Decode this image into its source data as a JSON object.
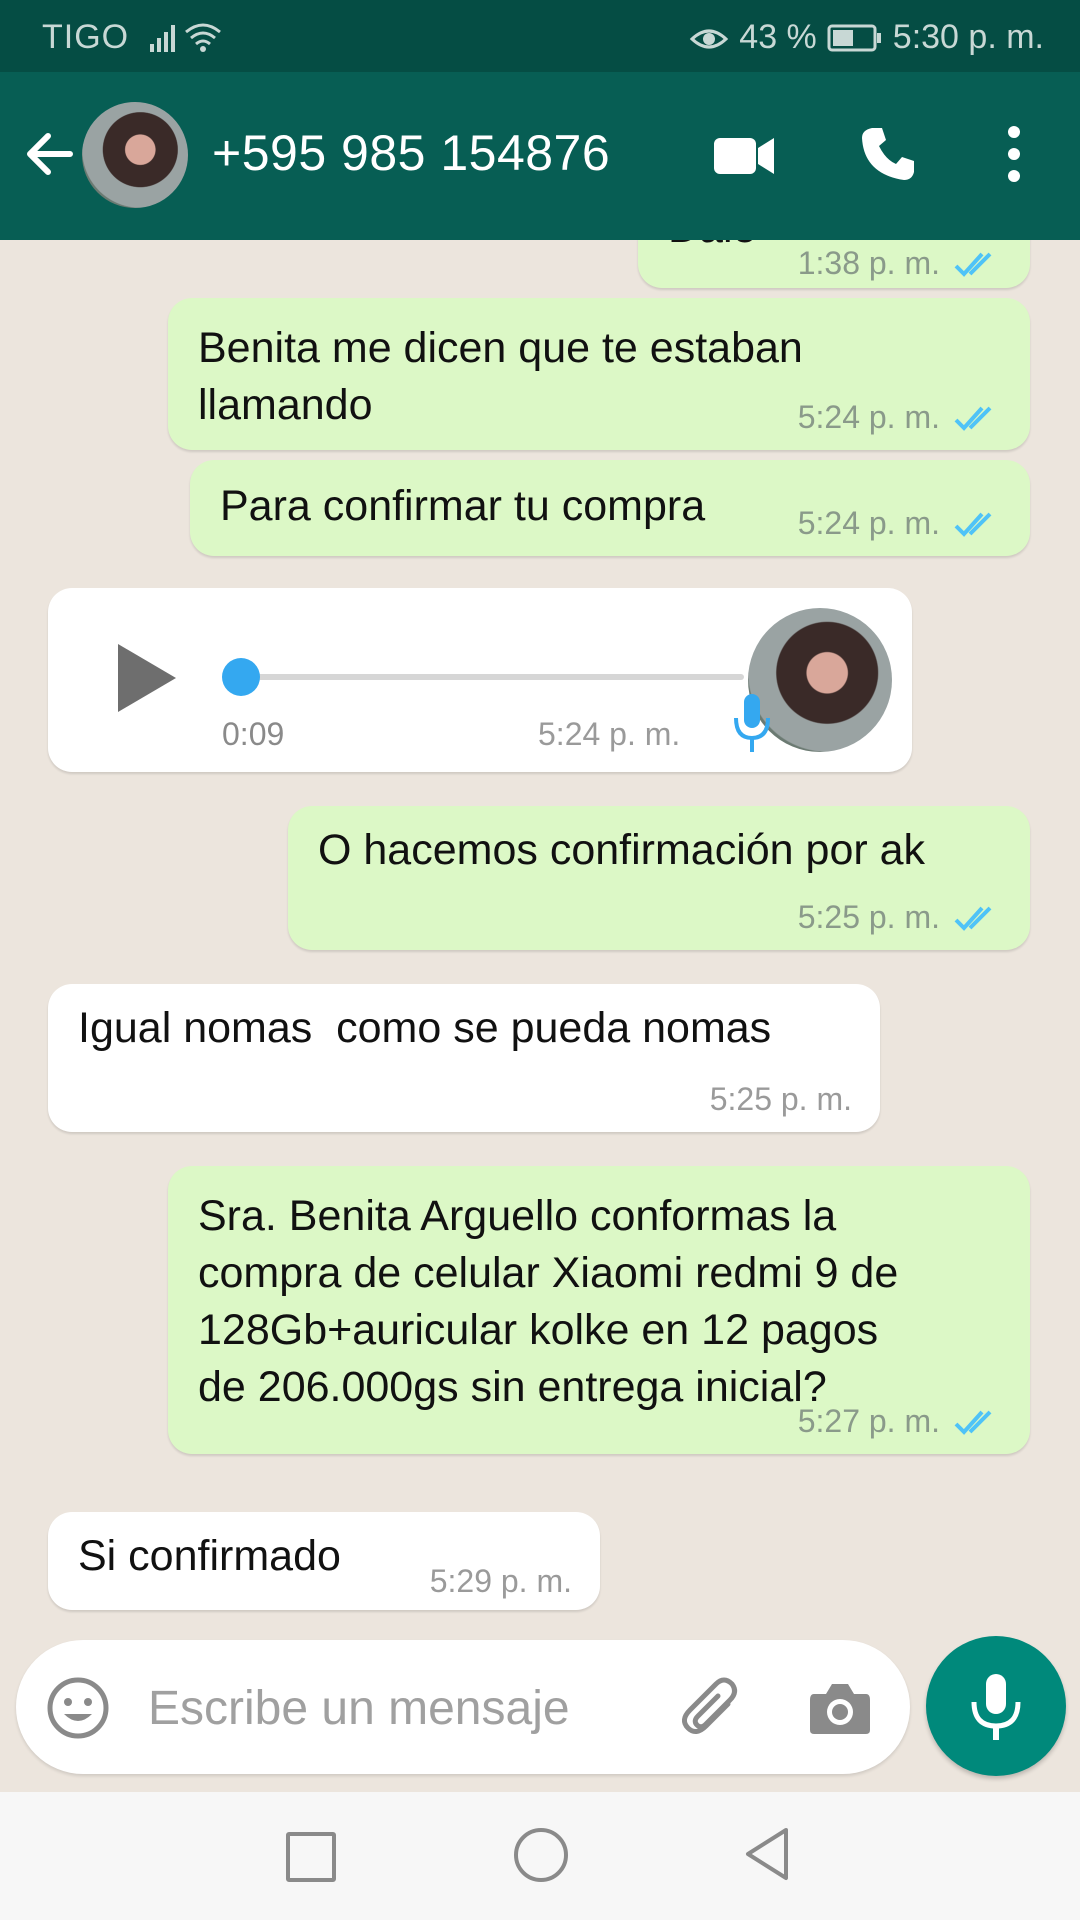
{
  "status_bar": {
    "carrier": "TIGO",
    "battery": "43 %",
    "time": "5:30 p. m."
  },
  "header": {
    "contact": "+595 985 154876",
    "icons": [
      "back-arrow-icon",
      "video-call-icon",
      "phone-icon",
      "more-vert-icon"
    ]
  },
  "messages": [
    {
      "direction": "out",
      "text": "Dale",
      "time": "1:38 p. m.",
      "read": true
    },
    {
      "direction": "out",
      "text": "Benita me dicen que te estaban llamando",
      "line1": "Benita me dicen que te estaban",
      "line2": "llamando",
      "time": "5:24 p. m.",
      "read": true
    },
    {
      "direction": "out",
      "text": "Para confirmar tu compra",
      "time": "5:24 p. m.",
      "read": true
    },
    {
      "direction": "in",
      "type": "voice",
      "duration": "0:09",
      "time": "5:24 p. m.",
      "progress": 0.0
    },
    {
      "direction": "out",
      "text": "O hacemos confirmación por ak",
      "time": "5:25 p. m.",
      "read": true
    },
    {
      "direction": "in",
      "text": "Igual nomas  como se pueda nomas",
      "time": "5:25 p. m."
    },
    {
      "direction": "out",
      "text": "Sra. Benita Arguello conformas la compra de celular Xiaomi redmi 9 de 128Gb+auricular kolke en 12 pagos de 206.000gs sin entrega inicial?",
      "line1": "Sra. Benita Arguello conformas la",
      "line2": "compra de celular Xiaomi redmi 9 de",
      "line3": "128Gb+auricular kolke en 12 pagos",
      "line4": "de 206.000gs sin entrega inicial?",
      "time": "5:27 p. m.",
      "read": true
    },
    {
      "direction": "in",
      "text": "Si confirmado",
      "time": "5:29 p. m."
    }
  ],
  "composer": {
    "placeholder": "Escribe un mensaje",
    "icons": [
      "emoji-icon",
      "attach-icon",
      "camera-icon",
      "mic-icon"
    ]
  },
  "colors": {
    "header": "#075e54",
    "status_bar": "#054d44",
    "outgoing_bubble": "#dcf8c6",
    "incoming_bubble": "#ffffff",
    "read_ticks": "#4fc3f7",
    "mic_button": "#00897b"
  }
}
